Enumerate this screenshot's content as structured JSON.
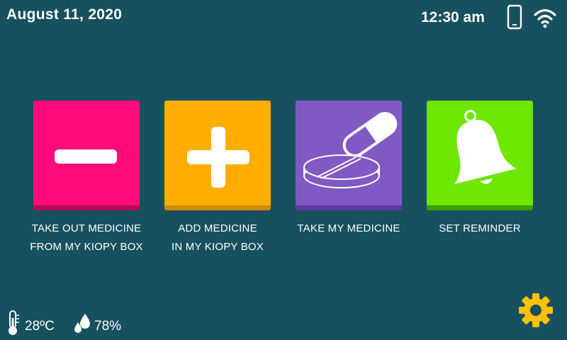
{
  "status": {
    "date": "August 11, 2020",
    "time": "12:30 am",
    "icons": [
      "phone-icon",
      "wifi-icon"
    ]
  },
  "tiles": [
    {
      "icon": "minus-icon",
      "color": "#ff0b7a",
      "label_line1": "TAKE OUT MEDICINE",
      "label_line2": "FROM MY KIOPY BOX"
    },
    {
      "icon": "plus-icon",
      "color": "#ffad00",
      "label_line1": "ADD MEDICINE",
      "label_line2": "IN MY KIOPY BOX"
    },
    {
      "icon": "pills-icon",
      "color": "#8059c4",
      "label_line1": "TAKE MY MEDICINE",
      "label_line2": ""
    },
    {
      "icon": "bell-icon",
      "color": "#6de600",
      "label_line1": "SET REMINDER",
      "label_line2": ""
    }
  ],
  "footer": {
    "temperature": "28ºC",
    "humidity": "78%",
    "icons": [
      "thermometer-icon",
      "water-drops-icon",
      "gear-icon"
    ],
    "accent_gear_color": "#ffc107"
  },
  "colors": {
    "background": "#17505f",
    "text": "#ffffff"
  }
}
